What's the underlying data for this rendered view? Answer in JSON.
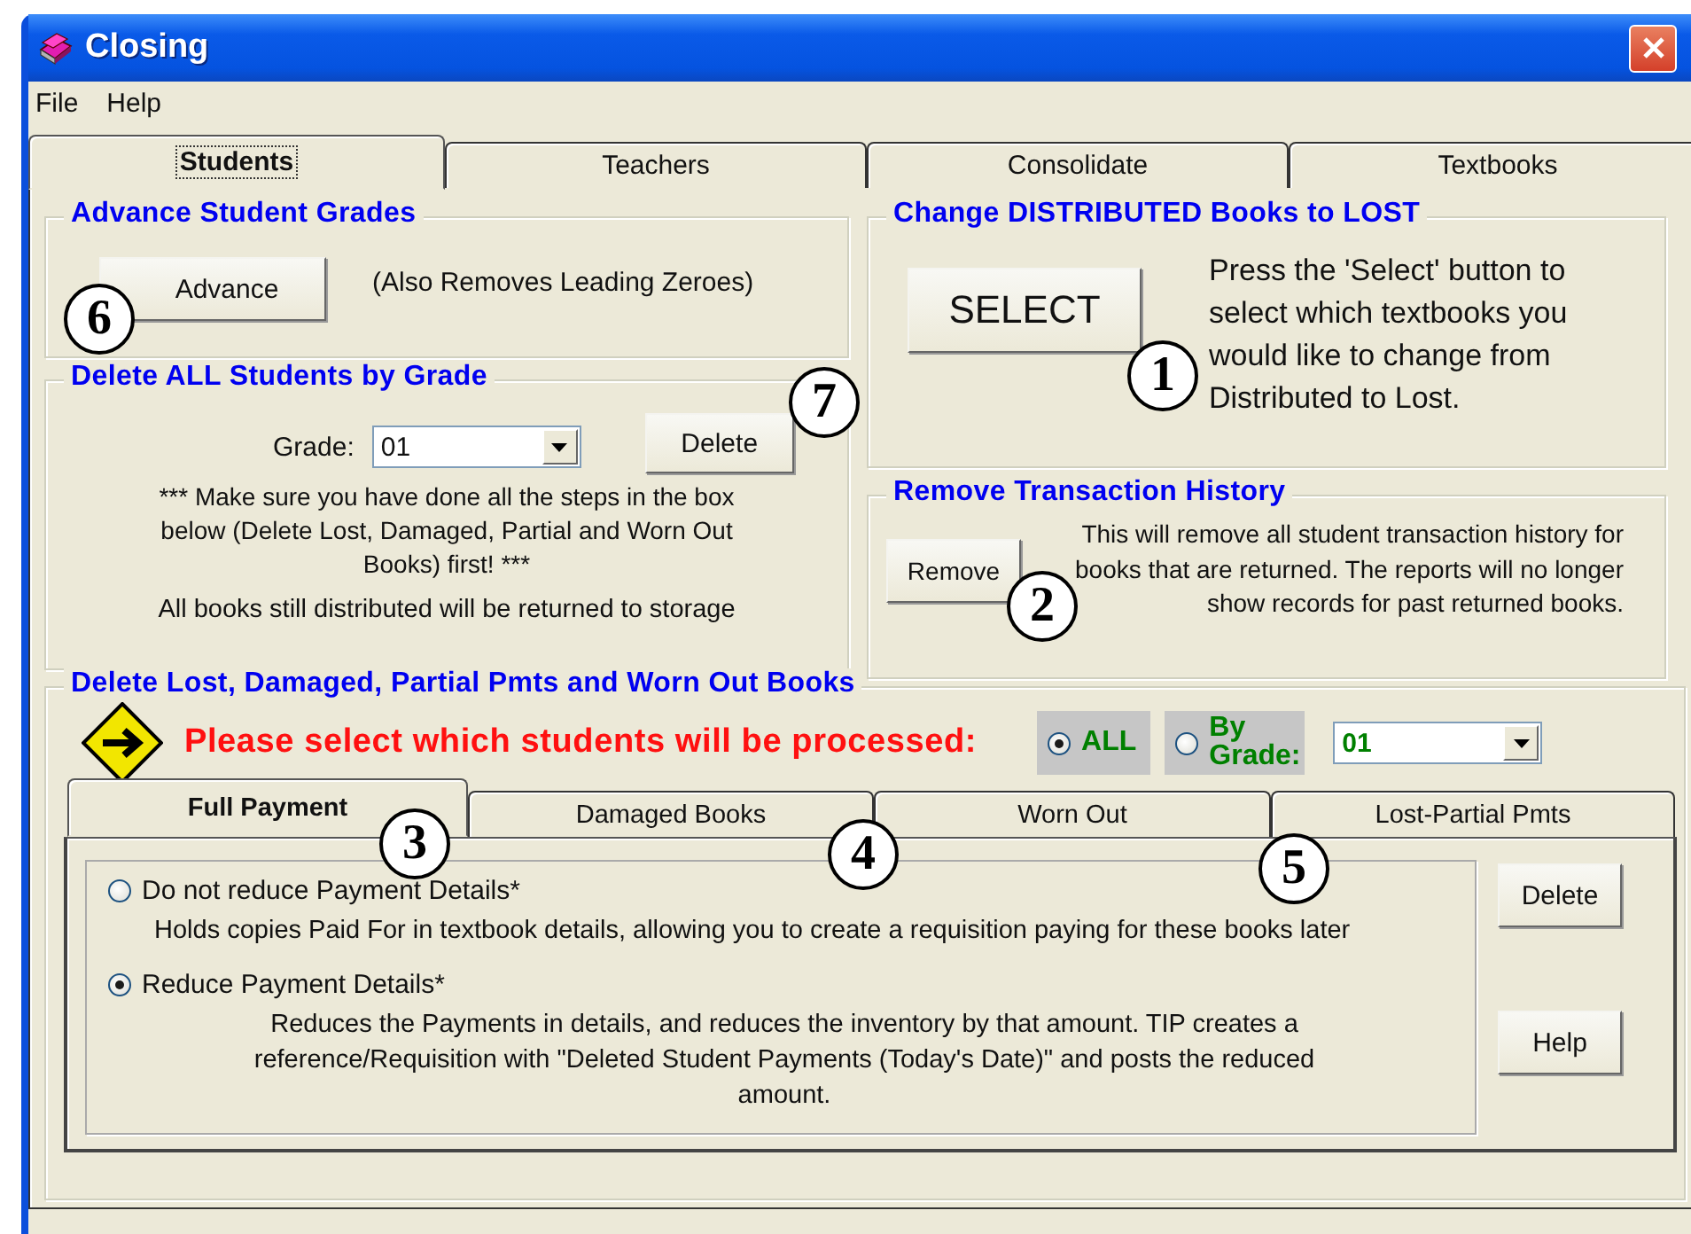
{
  "window": {
    "title": "Closing"
  },
  "menu": [
    "File",
    "Help"
  ],
  "tabs": [
    {
      "label": "Students",
      "selected": true
    },
    {
      "label": "Teachers",
      "selected": false
    },
    {
      "label": "Consolidate",
      "selected": false
    },
    {
      "label": "Textbooks",
      "selected": false
    }
  ],
  "advance_grades": {
    "title": "Advance Student Grades",
    "button": "Advance",
    "note": "(Also Removes Leading Zeroes)"
  },
  "delete_by_grade": {
    "title": "Delete ALL Students by Grade",
    "grade_label": "Grade:",
    "grade_value": "01",
    "button": "Delete",
    "warning": "*** Make sure you have done all the steps in the box below (Delete Lost, Damaged, Partial and Worn Out Books) first! ***",
    "note": "All books still distributed will be returned to storage"
  },
  "change_to_lost": {
    "title": "Change DISTRIBUTED Books to LOST",
    "button": "SELECT",
    "description": "Press the 'Select' button to select which textbooks you would like to change from Distributed to Lost."
  },
  "remove_history": {
    "title": "Remove Transaction History",
    "button": "Remove",
    "description": "This will remove all student transaction history for books that are returned.  The reports will no longer show records for past returned books."
  },
  "delete_books": {
    "title": "Delete Lost, Damaged, Partial Pmts and Worn Out Books",
    "prompt": "Please select which students will be processed:",
    "scope_options": [
      {
        "label": "ALL",
        "selected": true
      },
      {
        "label": "By Grade:",
        "selected": false
      }
    ],
    "grade_value": "01",
    "tabs": [
      {
        "label": "Full Payment",
        "selected": true
      },
      {
        "label": "Damaged Books",
        "selected": false
      },
      {
        "label": "Worn Out",
        "selected": false
      },
      {
        "label": "Lost-Partial Pmts",
        "selected": false
      }
    ],
    "options": [
      {
        "label": "Do not reduce Payment Details*",
        "description": "Holds copies Paid For in textbook details, allowing you to create a requisition paying for these books later",
        "selected": false
      },
      {
        "label": "Reduce Payment Details*",
        "description": "Reduces the Payments in details, and reduces the inventory by that amount.  TIP creates a reference/Requisition with \"Deleted Student Payments (Today's Date)\" and posts the reduced amount.",
        "selected": true
      }
    ],
    "buttons": [
      "Delete",
      "Help"
    ]
  },
  "callouts": [
    "1",
    "2",
    "3",
    "4",
    "5",
    "6",
    "7"
  ]
}
